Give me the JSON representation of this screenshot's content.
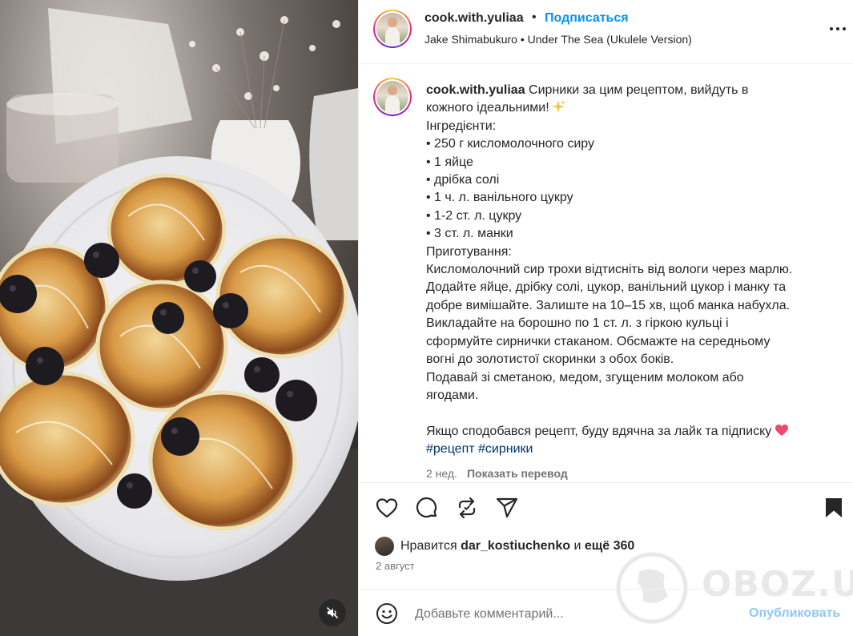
{
  "header": {
    "username": "cook.with.yuliaa",
    "separator": "•",
    "follow_label": "Подписаться",
    "audio": "Jake Shimabukuro • Under The Sea (Ukulele Version)",
    "more_icon": "more-horizontal-icon"
  },
  "caption": {
    "username": "cook.with.yuliaa",
    "lines": [
      "Сирники за цим рецептом, вийдуть в",
      "кожного ідеальними!",
      "Інгредієнти:",
      "• 250 г кисломолочного сиру",
      "• 1 яйце",
      "• дрібка солі",
      "• 1 ч. л. ванільного цукру",
      "• 1-2 ст. л. цукру",
      "• 3 ст. л. манки",
      "Приготування:",
      "Кисломолочний сир трохи відтисніть від вологи через марлю.",
      "Додайте яйце, дрібку солі, цукор, ванільний цукор і манку та",
      "добре вимішайте. Залиште на 10–15 хв, щоб манка набухла.",
      "Викладайте на борошно по 1 ст. л. з гіркою кульці і",
      "сформуйте сирнички стаканом. Обсмажте на середньому",
      "вогні до золотистої скоринки з обох боків.",
      "Подавай зі сметаною, медом, згущеним молоком або",
      "ягодами.",
      "Якщо сподобався рецепт, буду вдячна за лайк та підписку"
    ],
    "hashtags": [
      "#рецепт",
      "#сирники"
    ],
    "time_ago": "2 нед.",
    "translate_label": "Показать перевод"
  },
  "actions": {
    "like_icon": "heart-outline-icon",
    "comment_icon": "comment-bubble-icon",
    "repost_icon": "repost-icon",
    "share_icon": "share-paper-plane-icon",
    "save_icon": "bookmark-filled-icon"
  },
  "likes": {
    "prefix": "Нравится",
    "user": "dar_kostiuchenko",
    "conj": "и",
    "others": "ещё 360"
  },
  "post_date": "2 август",
  "comment": {
    "placeholder": "Добавьте комментарий...",
    "publish_label": "Опубликовать"
  },
  "watermark": "OBOZ.UA",
  "colors": {
    "link": "#0095f6",
    "hashtag": "#00376b",
    "muted": "#737373",
    "publish_disabled": "#8fc8f8",
    "heart_emoji": "#ed4a6e"
  }
}
